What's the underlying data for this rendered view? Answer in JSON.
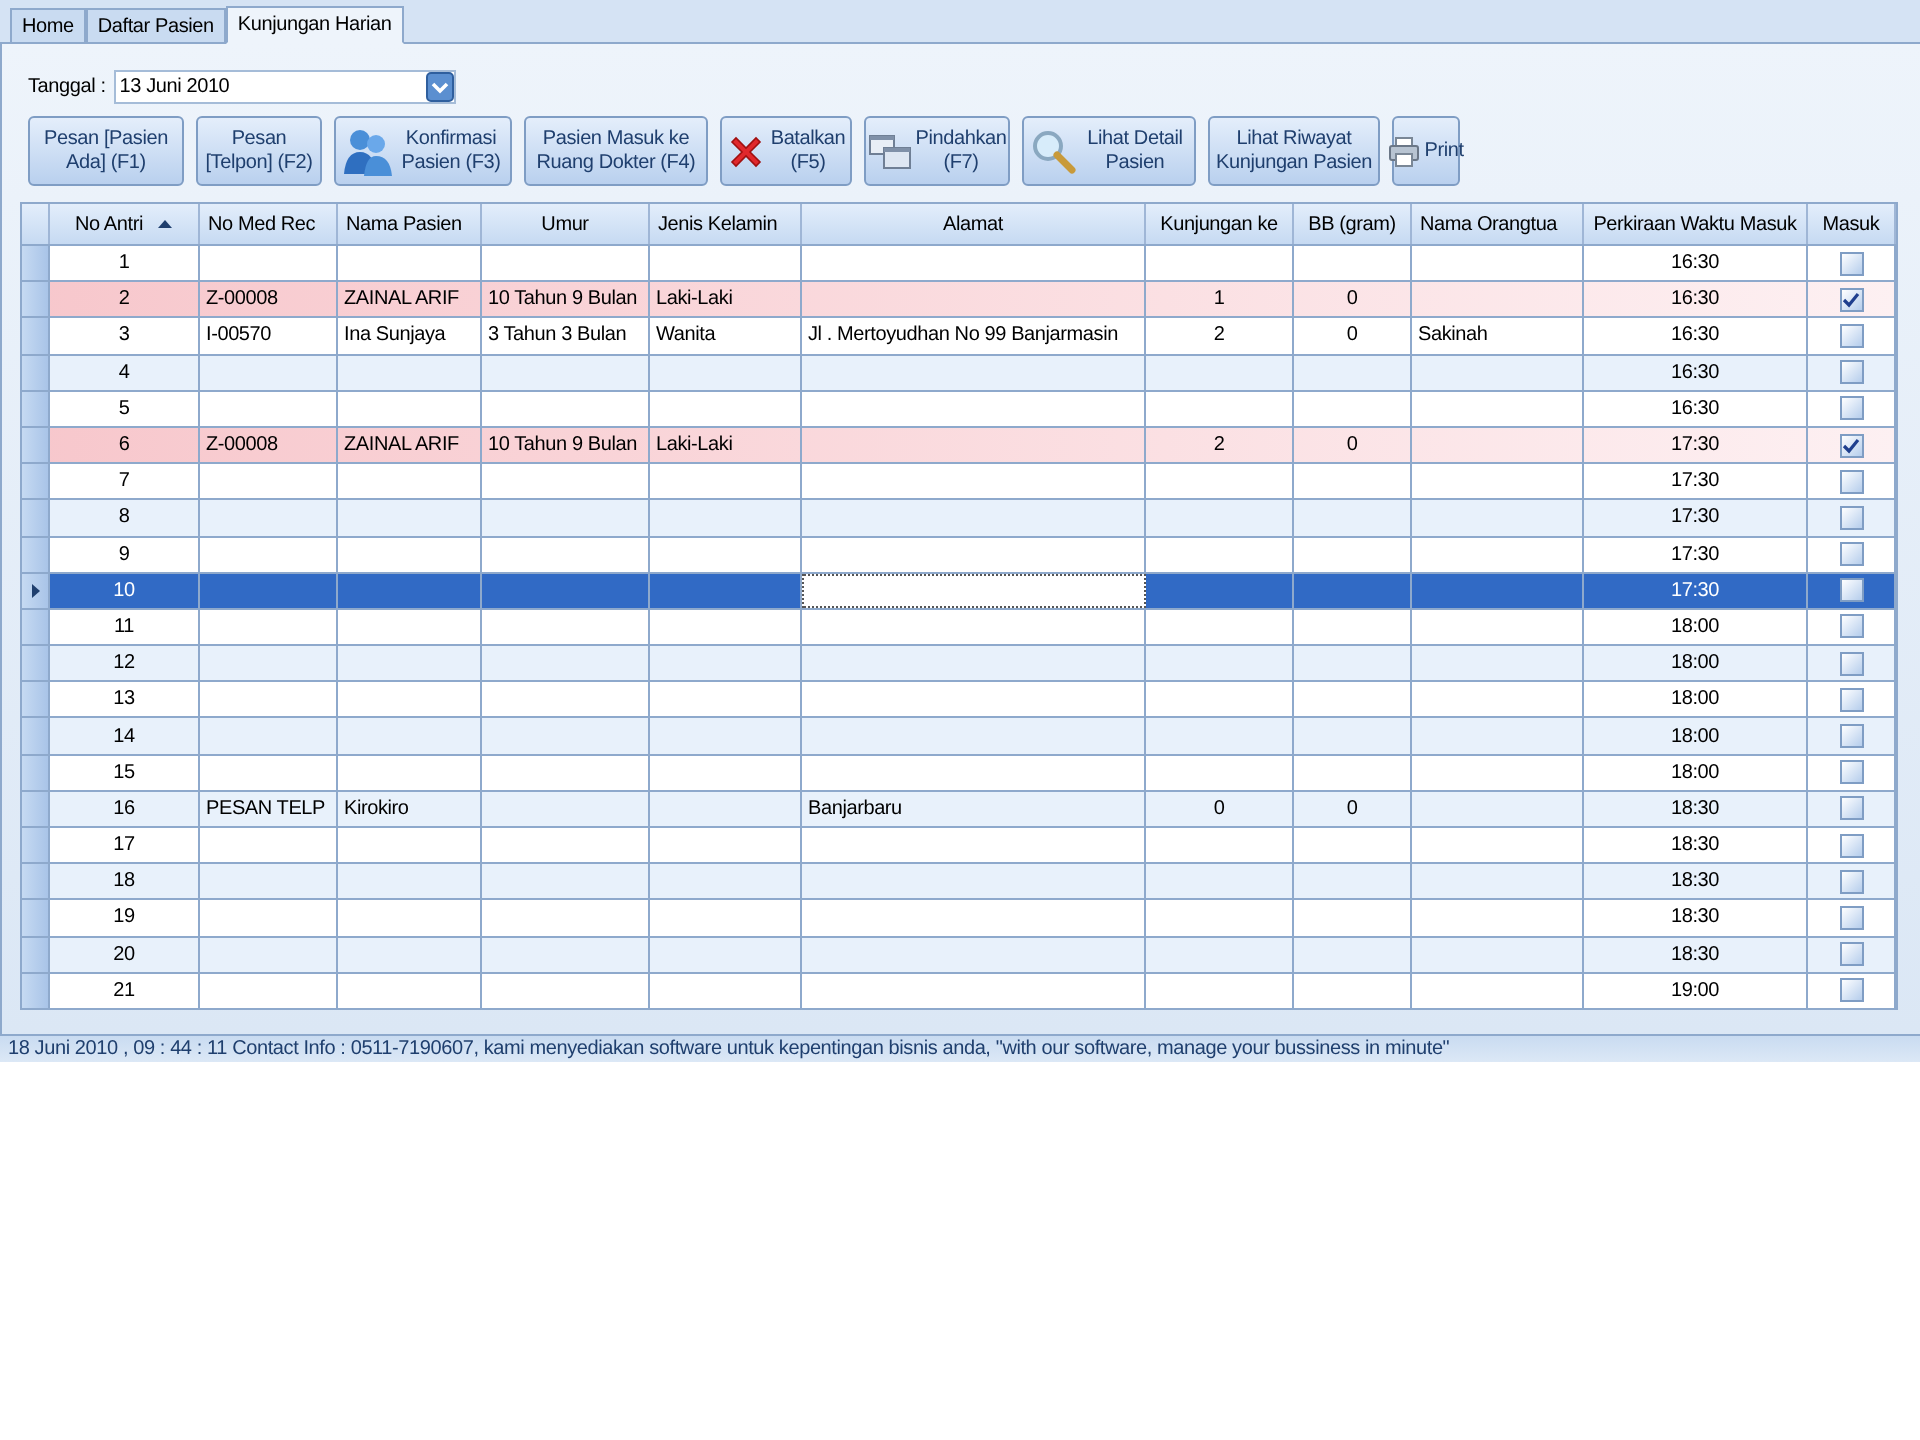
{
  "tabs": [
    {
      "label": "Home",
      "selected": false
    },
    {
      "label": "Daftar Pasien",
      "selected": false
    },
    {
      "label": "Kunjungan Harian",
      "selected": true
    }
  ],
  "date_field": {
    "label": "Tanggal :",
    "value": "13 Juni 2010"
  },
  "toolbar": [
    {
      "label": "Pesan [Pasien Ada] (F1)"
    },
    {
      "label": "Pesan [Telpon] (F2)"
    },
    {
      "label": "Konfirmasi Pasien (F3)"
    },
    {
      "label": "Pasien Masuk ke Ruang Dokter (F4)"
    },
    {
      "label": "Batalkan (F5)"
    },
    {
      "label": "Pindahkan (F7)"
    },
    {
      "label": "Lihat Detail Pasien"
    },
    {
      "label": "Lihat Riwayat Kunjungan Pasien"
    },
    {
      "label": "Print"
    }
  ],
  "table": {
    "columns": [
      {
        "label": "No Antri",
        "sorted": true
      },
      {
        "label": "No Med Rec"
      },
      {
        "label": "Nama Pasien"
      },
      {
        "label": "Umur"
      },
      {
        "label": "Jenis Kelamin"
      },
      {
        "label": "Alamat"
      },
      {
        "label": "Kunjungan ke"
      },
      {
        "label": "BB (gram)"
      },
      {
        "label": "Nama Orangtua"
      },
      {
        "label": "Perkiraan Waktu Masuk"
      },
      {
        "label": "Masuk"
      }
    ],
    "rows": [
      {
        "no": "1",
        "waktu": "16:30",
        "masuk": false,
        "highlighted": false,
        "selected": false
      },
      {
        "no": "2",
        "med_rec": "Z-00008",
        "nama": "ZAINAL ARIF",
        "umur": "10 Tahun 9 Bulan",
        "jk": "Laki-Laki",
        "kunjungan": "1",
        "bb": "0",
        "waktu": "16:30",
        "masuk": true,
        "highlighted": true,
        "selected": false
      },
      {
        "no": "3",
        "med_rec": "I-00570",
        "nama": "Ina Sunjaya",
        "umur": "3 Tahun 3 Bulan",
        "jk": "Wanita",
        "alamat": "Jl . Mertoyudhan  No 99 Banjarmasin",
        "kunjungan": "2",
        "bb": "0",
        "orangtua": "Sakinah",
        "waktu": "16:30",
        "masuk": false,
        "highlighted": false,
        "selected": false
      },
      {
        "no": "4",
        "waktu": "16:30",
        "masuk": false,
        "highlighted": false,
        "selected": false
      },
      {
        "no": "5",
        "waktu": "16:30",
        "masuk": false,
        "highlighted": false,
        "selected": false
      },
      {
        "no": "6",
        "med_rec": "Z-00008",
        "nama": "ZAINAL ARIF",
        "umur": "10 Tahun 9 Bulan",
        "jk": "Laki-Laki",
        "kunjungan": "2",
        "bb": "0",
        "waktu": "17:30",
        "masuk": true,
        "highlighted": true,
        "selected": false
      },
      {
        "no": "7",
        "waktu": "17:30",
        "masuk": false,
        "highlighted": false,
        "selected": false
      },
      {
        "no": "8",
        "waktu": "17:30",
        "masuk": false,
        "highlighted": false,
        "selected": false
      },
      {
        "no": "9",
        "waktu": "17:30",
        "masuk": false,
        "highlighted": false,
        "selected": false
      },
      {
        "no": "10",
        "waktu": "17:30",
        "masuk": false,
        "highlighted": false,
        "selected": true
      },
      {
        "no": "11",
        "waktu": "18:00",
        "masuk": false,
        "highlighted": false,
        "selected": false
      },
      {
        "no": "12",
        "waktu": "18:00",
        "masuk": false,
        "highlighted": false,
        "selected": false
      },
      {
        "no": "13",
        "waktu": "18:00",
        "masuk": false,
        "highlighted": false,
        "selected": false
      },
      {
        "no": "14",
        "waktu": "18:00",
        "masuk": false,
        "highlighted": false,
        "selected": false
      },
      {
        "no": "15",
        "waktu": "18:00",
        "masuk": false,
        "highlighted": false,
        "selected": false
      },
      {
        "no": "16",
        "med_rec": "PESAN TELP",
        "nama": "Kirokiro",
        "alamat": "Banjarbaru",
        "kunjungan": "0",
        "bb": "0",
        "waktu": "18:30",
        "masuk": false,
        "highlighted": false,
        "selected": false
      },
      {
        "no": "17",
        "waktu": "18:30",
        "masuk": false,
        "highlighted": false,
        "selected": false
      },
      {
        "no": "18",
        "waktu": "18:30",
        "masuk": false,
        "highlighted": false,
        "selected": false
      },
      {
        "no": "19",
        "waktu": "18:30",
        "masuk": false,
        "highlighted": false,
        "selected": false
      },
      {
        "no": "20",
        "waktu": "18:30",
        "masuk": false,
        "highlighted": false,
        "selected": false
      },
      {
        "no": "21",
        "waktu": "19:00",
        "masuk": false,
        "highlighted": false,
        "selected": false
      }
    ]
  },
  "status_bar": "18 Juni 2010 , 09 : 44 : 11  Contact Info : 0511-7190607, kami menyediakan software untuk kepentingan bisnis anda, \"with our software, manage your bussiness in minute\""
}
